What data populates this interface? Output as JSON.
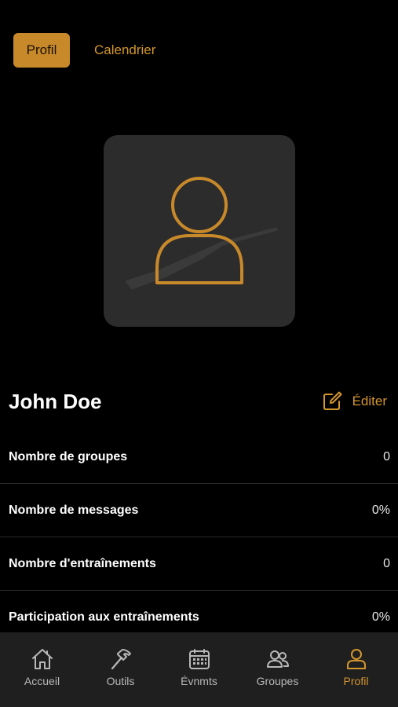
{
  "top_tabs": {
    "profile_label": "Profil",
    "calendar_label": "Calendrier"
  },
  "profile": {
    "name": "John Doe",
    "edit_label": "Éditer"
  },
  "stats": [
    {
      "label": "Nombre de groupes",
      "value": "0"
    },
    {
      "label": "Nombre de messages",
      "value": "0%"
    },
    {
      "label": "Nombre d'entraînements",
      "value": "0"
    },
    {
      "label": "Participation aux entraînements",
      "value": "0%"
    }
  ],
  "bottom_nav": [
    {
      "label": "Accueil",
      "icon": "home-icon"
    },
    {
      "label": "Outils",
      "icon": "hammer-icon"
    },
    {
      "label": "Évnmts",
      "icon": "calendar-icon"
    },
    {
      "label": "Groupes",
      "icon": "groups-icon"
    },
    {
      "label": "Profil",
      "icon": "person-icon",
      "active": true
    }
  ],
  "colors": {
    "accent": "#d4962e",
    "background": "#000000",
    "card": "#2c2c2c",
    "nav_background": "#1f1f1f"
  }
}
